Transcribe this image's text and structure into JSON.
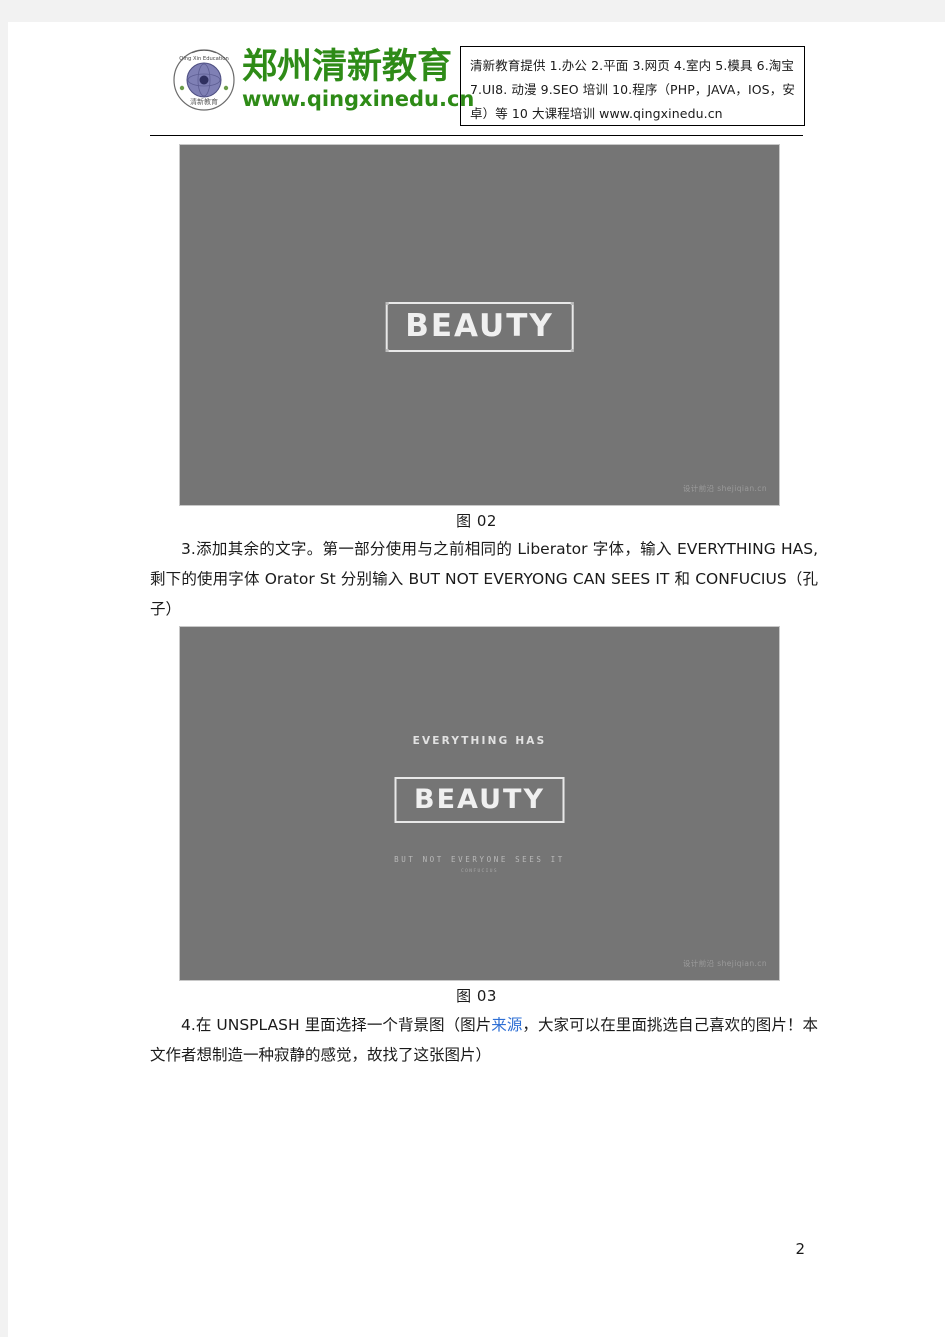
{
  "header": {
    "logo_icon": "qingxin-education-seal-icon",
    "brand_cn": "郑州清新教育",
    "brand_url": "www.qingxinedu.cn",
    "notice": "清新教育提供 1.办公 2.平面 3.网页 4.室内 5.模具 6.淘宝 7.UI8. 动漫 9.SEO 培训 10.程序（PHP，JAVA，IOS，安卓）等 10 大课程培训 www.qingxinedu.cn"
  },
  "figures": {
    "fig02": {
      "caption": "图 02",
      "beauty_word": "BEAUTY",
      "watermark": "设计前沿 shejiqian.cn",
      "background_color": "#757575"
    },
    "fig03": {
      "caption": "图 03",
      "everything_line": "EVERYTHING HAS",
      "beauty_word": "BEAUTY",
      "quote_line": "BUT NOT EVERYONE SEES IT",
      "attribution": "CONFUCIUS",
      "watermark": "设计前沿 shejiqian.cn",
      "background_color": "#757575"
    }
  },
  "paragraphs": {
    "step3": {
      "indent_marker": "",
      "part_a": "3.添加其余的文字。第一部分使用与之前相同的  Liberator 字体，输入 EVERYTHING HAS,剩下的使用字体 Orator  St 分别输入 BUT   NOT   EVERYONG    CAN    SEES    IT 和 CONFUCIUS（孔子）"
    },
    "step4": {
      "part_a": "4.在 UNSPLASH 里面选择一个背景图（图片",
      "link": "来源",
      "part_b": "，大家可以在里面挑选自己喜欢的图片！本文作者想制造一种寂静的感觉，故找了这张图片）"
    }
  },
  "footer": {
    "page_number": "2"
  },
  "colors": {
    "brand_green": "#2e8b17",
    "link_blue": "#2e6fd4",
    "image_gray": "#757575",
    "page_background": "#f2f2f2"
  }
}
